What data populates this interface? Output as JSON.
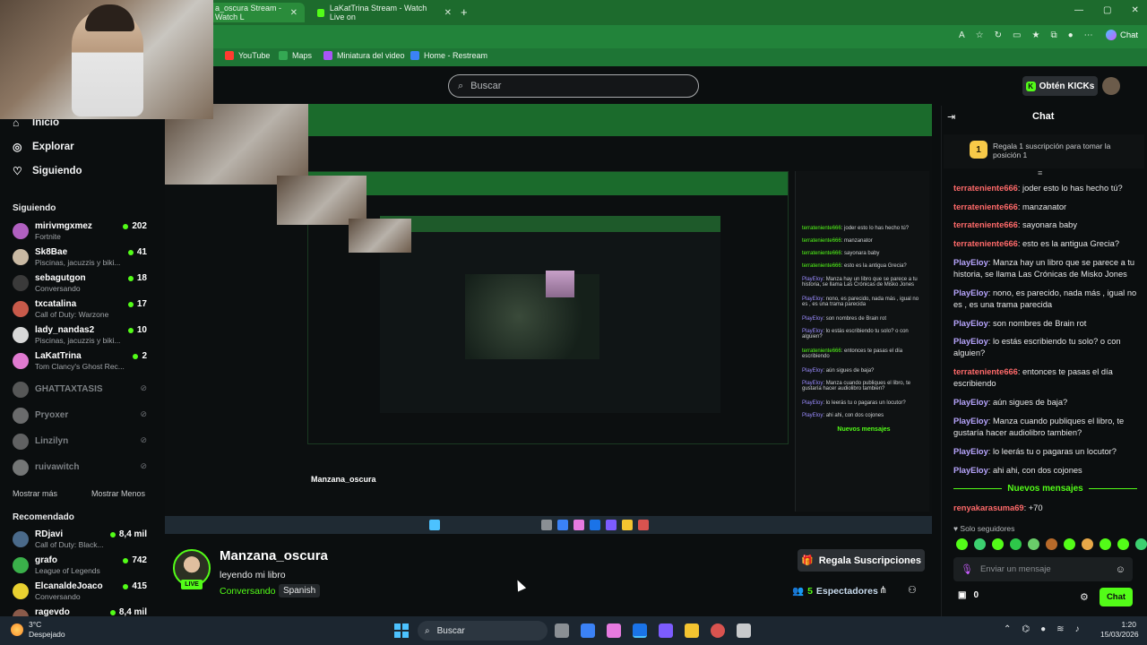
{
  "browser": {
    "tabs": [
      {
        "label": "a_oscura Stream - Watch L",
        "active": true
      },
      {
        "label": "LaKatTrina Stream - Watch Live on",
        "active": false
      }
    ],
    "bookmarks": [
      {
        "label": "YouTube",
        "color": "#ff3b30"
      },
      {
        "label": "Maps",
        "color": "#34a853"
      },
      {
        "label": "Miniatura del video",
        "color": "#a855f7"
      },
      {
        "label": "Home - Restream",
        "color": "#3b82f6"
      }
    ],
    "chat_button": "Chat"
  },
  "header": {
    "search_placeholder": "Buscar",
    "kicks_button": "Obtén KICKs"
  },
  "sidebar": {
    "nav": [
      {
        "label": "Inicio",
        "icon": "home-icon"
      },
      {
        "label": "Explorar",
        "icon": "compass-icon"
      },
      {
        "label": "Siguiendo",
        "icon": "heart-icon"
      }
    ],
    "following_title": "Siguiendo",
    "following": [
      {
        "name": "mirivmgxmez",
        "game": "Fortnite",
        "viewers": "202",
        "color": "#b060c0"
      },
      {
        "name": "Sk8Bae",
        "game": "Piscinas, jacuzzis y biki...",
        "viewers": "41",
        "color": "#c9b9a3"
      },
      {
        "name": "sebagutgon",
        "game": "Conversando",
        "viewers": "18",
        "color": "#2a2a2a"
      },
      {
        "name": "txcatalina",
        "game": "Call of Duty: Warzone",
        "viewers": "17",
        "color": "#c85a4a"
      },
      {
        "name": "lady_nandas2",
        "game": "Piscinas, jacuzzis y biki...",
        "viewers": "10",
        "color": "#d8d8d8"
      },
      {
        "name": "LaKatTrina",
        "game": "Tom Clancy's Ghost Rec...",
        "viewers": "2",
        "color": "#e07ad0"
      }
    ],
    "offline": [
      {
        "name": "GHATTAXTASIS"
      },
      {
        "name": "Pryoxer"
      },
      {
        "name": "Linzilyn"
      },
      {
        "name": "ruivawitch"
      }
    ],
    "show_more": "Mostrar más",
    "show_less": "Mostrar Menos",
    "recommended_title": "Recomendado",
    "recommended": [
      {
        "name": "RDjavi",
        "game": "Call of Duty: Black...",
        "viewers": "8,4 mil",
        "color": "#4a6a8a"
      },
      {
        "name": "grafo",
        "game": "League of Legends",
        "viewers": "742",
        "color": "#3ab04a"
      },
      {
        "name": "ElcanaldeJoaco",
        "game": "Conversando",
        "viewers": "415",
        "color": "#e8d030"
      },
      {
        "name": "ragevdo",
        "game": "",
        "viewers": "8,4 mil",
        "color": "#8a5a4a"
      }
    ]
  },
  "stream": {
    "inner_messages": [
      {
        "user": "terrateniente666",
        "text": "joder esto lo has hecho tú?",
        "kind": "red"
      },
      {
        "user": "terrateniente666",
        "text": "manzanator",
        "kind": "red"
      },
      {
        "user": "terrateniente666",
        "text": "sayonara baby",
        "kind": "red"
      },
      {
        "user": "terrateniente666",
        "text": "esto es la antigua Grecia?",
        "kind": "red"
      },
      {
        "user": "PlayEloy",
        "text": "Manza hay un libro que se parece a tu historia, se llama Las Crónicas de Misko Jones",
        "kind": "purple"
      },
      {
        "user": "PlayEloy",
        "text": "nono, es parecido, nada más , igual no es , es una trama parecida",
        "kind": "purple"
      },
      {
        "user": "PlayEloy",
        "text": "son nombres de Brain rot",
        "kind": "purple"
      },
      {
        "user": "PlayEloy",
        "text": "lo estás escribiendo tu solo? o con alguien?",
        "kind": "purple"
      },
      {
        "user": "terrateniente666",
        "text": "entonces te pasas el día escribiendo",
        "kind": "red"
      },
      {
        "user": "PlayEloy",
        "text": "aún sigues de baja?",
        "kind": "purple"
      },
      {
        "user": "PlayEloy",
        "text": "Manza cuando publiques el libro, te gustaría hacer audiolibro tambien?",
        "kind": "purple"
      },
      {
        "user": "PlayEloy",
        "text": "lo leerás tu o pagaras un locutor?",
        "kind": "purple"
      },
      {
        "user": "PlayEloy",
        "text": "ahi ahi, con dos cojones",
        "kind": "purple"
      }
    ],
    "inner_title": "Manzana_oscura",
    "inner_nuevos": "Nuevos mensajes"
  },
  "channel": {
    "name": "Manzana_oscura",
    "live": "LIVE",
    "title": "leyendo mi libro",
    "category": "Conversando",
    "tag": "Spanish",
    "gift_button": "Regala Suscripciones",
    "viewers_count": "5",
    "viewers_label": "Espectadores"
  },
  "chat": {
    "title": "Chat",
    "pinned_rank": "1",
    "pinned_text": "Regala 1 suscripción para tomar la posición 1",
    "messages": [
      {
        "user": "terrateniente666",
        "text": "joder esto lo has hecho tú?",
        "kind": "red"
      },
      {
        "user": "terrateniente666",
        "text": "manzanator",
        "kind": "red"
      },
      {
        "user": "terrateniente666",
        "text": "sayonara baby",
        "kind": "red"
      },
      {
        "user": "terrateniente666",
        "text": "esto es la antigua Grecia?",
        "kind": "red"
      },
      {
        "user": "PlayEloy",
        "text": "Manza hay un libro que se parece a tu historia, se llama Las Crónicas de Misko Jones",
        "kind": "purple"
      },
      {
        "user": "PlayEloy",
        "text": "nono, es parecido, nada más , igual no es , es una trama parecida",
        "kind": "purple"
      },
      {
        "user": "PlayEloy",
        "text": "son nombres de Brain rot",
        "kind": "purple"
      },
      {
        "user": "PlayEloy",
        "text": "lo estás escribiendo tu solo? o con alguien?",
        "kind": "purple"
      },
      {
        "user": "terrateniente666",
        "text": "entonces te pasas el día escribiendo",
        "kind": "red"
      },
      {
        "user": "PlayEloy",
        "text": "aún sigues de baja?",
        "kind": "purple"
      },
      {
        "user": "PlayEloy",
        "text": "Manza cuando publiques el libro, te gustaría hacer audiolibro tambien?",
        "kind": "purple"
      },
      {
        "user": "PlayEloy",
        "text": "lo leerás tu o pagaras un locutor?",
        "kind": "purple"
      },
      {
        "user": "PlayEloy",
        "text": "ahi ahi, con dos cojones",
        "kind": "purple"
      }
    ],
    "new_messages": "Nuevos mensajes",
    "after_new": {
      "user": "renyakarasuma69",
      "text": "+70",
      "kind": "red"
    },
    "followers_only": "Solo seguidores",
    "input_placeholder": "Enviar un mensaje",
    "points": "0",
    "send_button": "Chat",
    "emote_colors": [
      "#53fc18",
      "#3cd070",
      "#53fc18",
      "#2ec84a",
      "#6acd6a",
      "#b86a2a",
      "#53fc18",
      "#e8a848",
      "#53fc18",
      "#53fc18",
      "#3cd070",
      "#53fc18"
    ]
  },
  "taskbar": {
    "temp": "3°C",
    "weather": "Despejado",
    "search": "Buscar",
    "time": "1:20",
    "date": "15/03/2026",
    "app_colors": [
      "#8a8f94",
      "#3b82f6",
      "#e67ae0",
      "#1a73e8",
      "#7c5cff",
      "#f4c430",
      "#d9534f",
      "#c8cacc"
    ]
  }
}
